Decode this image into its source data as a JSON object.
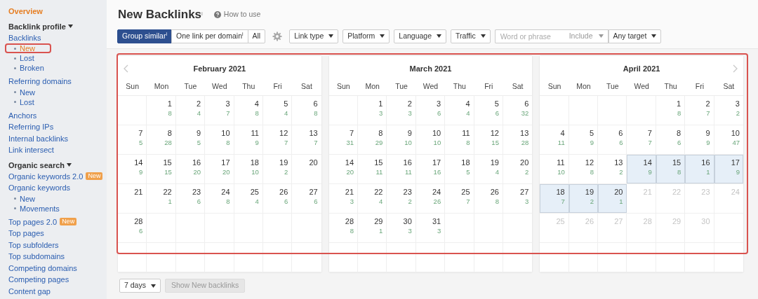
{
  "sidebar": {
    "items": [
      {
        "kind": "top",
        "label": "Overview"
      },
      {
        "kind": "heading",
        "label": "Backlink profile",
        "expanded": true
      },
      {
        "kind": "link",
        "label": "Backlinks",
        "children": [
          {
            "label": "New",
            "selected": true,
            "highlighted": true
          },
          {
            "label": "Lost",
            "selected": false,
            "highlighted": false
          },
          {
            "label": "Broken",
            "selected": false,
            "highlighted": false
          }
        ]
      },
      {
        "kind": "link",
        "label": "Referring domains",
        "children": [
          {
            "label": "New",
            "selected": false,
            "highlighted": false
          },
          {
            "label": "Lost",
            "selected": false,
            "highlighted": false
          }
        ]
      },
      {
        "kind": "link",
        "label": "Anchors"
      },
      {
        "kind": "link",
        "label": "Referring IPs"
      },
      {
        "kind": "link",
        "label": "Internal backlinks"
      },
      {
        "kind": "link",
        "label": "Link intersect"
      },
      {
        "kind": "heading",
        "label": "Organic search",
        "expanded": true
      },
      {
        "kind": "link",
        "label": "Organic keywords 2.0",
        "badge": "New"
      },
      {
        "kind": "link",
        "label": "Organic keywords",
        "children": [
          {
            "label": "New",
            "selected": false,
            "highlighted": false
          },
          {
            "label": "Movements",
            "selected": false,
            "highlighted": false
          }
        ]
      },
      {
        "kind": "link",
        "label": "Top pages 2.0",
        "badge": "New"
      },
      {
        "kind": "link",
        "label": "Top pages"
      },
      {
        "kind": "link",
        "label": "Top subfolders"
      },
      {
        "kind": "link",
        "label": "Top subdomains"
      },
      {
        "kind": "link",
        "label": "Competing domains"
      },
      {
        "kind": "link",
        "label": "Competing pages"
      },
      {
        "kind": "link",
        "label": "Content gap"
      }
    ]
  },
  "header": {
    "title": "New Backlinks$^{i}$",
    "help_link": "How to use"
  },
  "toolbar": {
    "modes": [
      {
        "label": "Group similar$^{i}$",
        "selected": true
      },
      {
        "label": "One link per domain$^{i}$",
        "selected": false
      },
      {
        "label": "All",
        "selected": false
      }
    ],
    "filters": [
      "Link type",
      "Platform",
      "Language",
      "Traffic"
    ],
    "search": {
      "placeholder": "Word or phrase",
      "mode": "Include",
      "target": "Any target"
    }
  },
  "calendar": {
    "highlighted": true,
    "months": [
      {
        "title": "February 2021",
        "prev_button": true,
        "next_button": false,
        "weekdays": [
          "Sun",
          "Mon",
          "Tue",
          "Wed",
          "Thu",
          "Fri",
          "Sat"
        ],
        "weeks": [
          [
            {
              "kind": "blank"
            },
            {
              "kind": "day",
              "day": "1",
              "count": "8",
              "selected": false,
              "disabled": false
            },
            {
              "kind": "day",
              "day": "2",
              "count": "4",
              "selected": false,
              "disabled": false
            },
            {
              "kind": "day",
              "day": "3",
              "count": "7",
              "selected": false,
              "disabled": false
            },
            {
              "kind": "day",
              "day": "4",
              "count": "8",
              "selected": false,
              "disabled": false
            },
            {
              "kind": "day",
              "day": "5",
              "count": "4",
              "selected": false,
              "disabled": false
            },
            {
              "kind": "day",
              "day": "6",
              "count": "8",
              "selected": false,
              "disabled": false
            }
          ],
          [
            {
              "kind": "day",
              "day": "7",
              "count": "5",
              "selected": false,
              "disabled": false
            },
            {
              "kind": "day",
              "day": "8",
              "count": "28",
              "selected": false,
              "disabled": false
            },
            {
              "kind": "day",
              "day": "9",
              "count": "5",
              "selected": false,
              "disabled": false
            },
            {
              "kind": "day",
              "day": "10",
              "count": "8",
              "selected": false,
              "disabled": false
            },
            {
              "kind": "day",
              "day": "11",
              "count": "9",
              "selected": false,
              "disabled": false
            },
            {
              "kind": "day",
              "day": "12",
              "count": "7",
              "selected": false,
              "disabled": false
            },
            {
              "kind": "day",
              "day": "13",
              "count": "7",
              "selected": false,
              "disabled": false
            }
          ],
          [
            {
              "kind": "day",
              "day": "14",
              "count": "9",
              "selected": false,
              "disabled": false
            },
            {
              "kind": "day",
              "day": "15",
              "count": "15",
              "selected": false,
              "disabled": false
            },
            {
              "kind": "day",
              "day": "16",
              "count": "20",
              "selected": false,
              "disabled": false
            },
            {
              "kind": "day",
              "day": "17",
              "count": "20",
              "selected": false,
              "disabled": false
            },
            {
              "kind": "day",
              "day": "18",
              "count": "10",
              "selected": false,
              "disabled": false
            },
            {
              "kind": "day",
              "day": "19",
              "count": "2",
              "selected": false,
              "disabled": false
            },
            {
              "kind": "day",
              "day": "20",
              "selected": false,
              "disabled": false
            }
          ],
          [
            {
              "kind": "day",
              "day": "21",
              "selected": false,
              "disabled": false
            },
            {
              "kind": "day",
              "day": "22",
              "count": "1",
              "selected": false,
              "disabled": false
            },
            {
              "kind": "day",
              "day": "23",
              "count": "6",
              "selected": false,
              "disabled": false
            },
            {
              "kind": "day",
              "day": "24",
              "count": "8",
              "selected": false,
              "disabled": false
            },
            {
              "kind": "day",
              "day": "25",
              "count": "4",
              "selected": false,
              "disabled": false
            },
            {
              "kind": "day",
              "day": "26",
              "count": "6",
              "selected": false,
              "disabled": false
            },
            {
              "kind": "day",
              "day": "27",
              "count": "6",
              "selected": false,
              "disabled": false
            }
          ],
          [
            {
              "kind": "day",
              "day": "28",
              "count": "6",
              "selected": false,
              "disabled": false
            },
            {
              "kind": "blank"
            },
            {
              "kind": "blank"
            },
            {
              "kind": "blank"
            },
            {
              "kind": "blank"
            },
            {
              "kind": "blank"
            },
            {
              "kind": "blank"
            }
          ],
          [
            {
              "kind": "blank"
            },
            {
              "kind": "blank"
            },
            {
              "kind": "blank"
            },
            {
              "kind": "blank"
            },
            {
              "kind": "blank"
            },
            {
              "kind": "blank"
            },
            {
              "kind": "blank"
            }
          ]
        ]
      },
      {
        "title": "March 2021",
        "prev_button": false,
        "next_button": false,
        "weekdays": [
          "Sun",
          "Mon",
          "Tue",
          "Wed",
          "Thu",
          "Fri",
          "Sat"
        ],
        "weeks": [
          [
            {
              "kind": "blank"
            },
            {
              "kind": "day",
              "day": "1",
              "count": "3",
              "selected": false,
              "disabled": false
            },
            {
              "kind": "day",
              "day": "2",
              "count": "3",
              "selected": false,
              "disabled": false
            },
            {
              "kind": "day",
              "day": "3",
              "count": "6",
              "selected": false,
              "disabled": false
            },
            {
              "kind": "day",
              "day": "4",
              "count": "4",
              "selected": false,
              "disabled": false
            },
            {
              "kind": "day",
              "day": "5",
              "count": "6",
              "selected": false,
              "disabled": false
            },
            {
              "kind": "day",
              "day": "6",
              "count": "32",
              "selected": false,
              "disabled": false
            }
          ],
          [
            {
              "kind": "day",
              "day": "7",
              "count": "31",
              "selected": false,
              "disabled": false
            },
            {
              "kind": "day",
              "day": "8",
              "count": "29",
              "selected": false,
              "disabled": false
            },
            {
              "kind": "day",
              "day": "9",
              "count": "10",
              "selected": false,
              "disabled": false
            },
            {
              "kind": "day",
              "day": "10",
              "count": "10",
              "selected": false,
              "disabled": false
            },
            {
              "kind": "day",
              "day": "11",
              "count": "8",
              "selected": false,
              "disabled": false
            },
            {
              "kind": "day",
              "day": "12",
              "count": "15",
              "selected": false,
              "disabled": false
            },
            {
              "kind": "day",
              "day": "13",
              "count": "28",
              "selected": false,
              "disabled": false
            }
          ],
          [
            {
              "kind": "day",
              "day": "14",
              "count": "20",
              "selected": false,
              "disabled": false
            },
            {
              "kind": "day",
              "day": "15",
              "count": "11",
              "selected": false,
              "disabled": false
            },
            {
              "kind": "day",
              "day": "16",
              "count": "11",
              "selected": false,
              "disabled": false
            },
            {
              "kind": "day",
              "day": "17",
              "count": "16",
              "selected": false,
              "disabled": false
            },
            {
              "kind": "day",
              "day": "18",
              "count": "5",
              "selected": false,
              "disabled": false
            },
            {
              "kind": "day",
              "day": "19",
              "count": "4",
              "selected": false,
              "disabled": false
            },
            {
              "kind": "day",
              "day": "20",
              "count": "2",
              "selected": false,
              "disabled": false
            }
          ],
          [
            {
              "kind": "day",
              "day": "21",
              "count": "3",
              "selected": false,
              "disabled": false
            },
            {
              "kind": "day",
              "day": "22",
              "count": "4",
              "selected": false,
              "disabled": false
            },
            {
              "kind": "day",
              "day": "23",
              "count": "2",
              "selected": false,
              "disabled": false
            },
            {
              "kind": "day",
              "day": "24",
              "count": "26",
              "selected": false,
              "disabled": false
            },
            {
              "kind": "day",
              "day": "25",
              "count": "7",
              "selected": false,
              "disabled": false
            },
            {
              "kind": "day",
              "day": "26",
              "count": "8",
              "selected": false,
              "disabled": false
            },
            {
              "kind": "day",
              "day": "27",
              "count": "3",
              "selected": false,
              "disabled": false
            }
          ],
          [
            {
              "kind": "day",
              "day": "28",
              "count": "8",
              "selected": false,
              "disabled": false
            },
            {
              "kind": "day",
              "day": "29",
              "count": "1",
              "selected": false,
              "disabled": false
            },
            {
              "kind": "day",
              "day": "30",
              "count": "3",
              "selected": false,
              "disabled": false
            },
            {
              "kind": "day",
              "day": "31",
              "count": "3",
              "selected": false,
              "disabled": false
            },
            {
              "kind": "blank"
            },
            {
              "kind": "blank"
            },
            {
              "kind": "blank"
            }
          ],
          [
            {
              "kind": "blank"
            },
            {
              "kind": "blank"
            },
            {
              "kind": "blank"
            },
            {
              "kind": "blank"
            },
            {
              "kind": "blank"
            },
            {
              "kind": "blank"
            },
            {
              "kind": "blank"
            }
          ]
        ]
      },
      {
        "title": "April 2021",
        "prev_button": false,
        "next_button": true,
        "weekdays": [
          "Sun",
          "Mon",
          "Tue",
          "Wed",
          "Thu",
          "Fri",
          "Sat"
        ],
        "weeks": [
          [
            {
              "kind": "blank"
            },
            {
              "kind": "blank"
            },
            {
              "kind": "blank"
            },
            {
              "kind": "blank"
            },
            {
              "kind": "day",
              "day": "1",
              "count": "8",
              "selected": false,
              "disabled": false
            },
            {
              "kind": "day",
              "day": "2",
              "count": "7",
              "selected": false,
              "disabled": false
            },
            {
              "kind": "day",
              "day": "3",
              "count": "2",
              "selected": false,
              "disabled": false
            }
          ],
          [
            {
              "kind": "day",
              "day": "4",
              "count": "11",
              "selected": false,
              "disabled": false
            },
            {
              "kind": "day",
              "day": "5",
              "count": "9",
              "selected": false,
              "disabled": false
            },
            {
              "kind": "day",
              "day": "6",
              "count": "6",
              "selected": false,
              "disabled": false
            },
            {
              "kind": "day",
              "day": "7",
              "count": "7",
              "selected": false,
              "disabled": false
            },
            {
              "kind": "day",
              "day": "8",
              "count": "6",
              "selected": false,
              "disabled": false
            },
            {
              "kind": "day",
              "day": "9",
              "count": "9",
              "selected": false,
              "disabled": false
            },
            {
              "kind": "day",
              "day": "10",
              "count": "47",
              "selected": false,
              "disabled": false
            }
          ],
          [
            {
              "kind": "day",
              "day": "11",
              "count": "10",
              "selected": false,
              "disabled": false
            },
            {
              "kind": "day",
              "day": "12",
              "count": "8",
              "selected": false,
              "disabled": false
            },
            {
              "kind": "day",
              "day": "13",
              "count": "2",
              "selected": false,
              "disabled": false
            },
            {
              "kind": "day",
              "day": "14",
              "count": "9",
              "selected": true,
              "disabled": false
            },
            {
              "kind": "day",
              "day": "15",
              "count": "8",
              "selected": true,
              "disabled": false
            },
            {
              "kind": "day",
              "day": "16",
              "count": "1",
              "selected": true,
              "disabled": false
            },
            {
              "kind": "day",
              "day": "17",
              "count": "9",
              "selected": true,
              "disabled": false
            }
          ],
          [
            {
              "kind": "day",
              "day": "18",
              "count": "7",
              "selected": true,
              "disabled": false
            },
            {
              "kind": "day",
              "day": "19",
              "count": "2",
              "selected": true,
              "disabled": false
            },
            {
              "kind": "day",
              "day": "20",
              "count": "1",
              "selected": true,
              "disabled": false
            },
            {
              "kind": "day",
              "day": "21",
              "selected": false,
              "disabled": true
            },
            {
              "kind": "day",
              "day": "22",
              "selected": false,
              "disabled": true
            },
            {
              "kind": "day",
              "day": "23",
              "selected": false,
              "disabled": true
            },
            {
              "kind": "day",
              "day": "24",
              "selected": false,
              "disabled": true
            }
          ],
          [
            {
              "kind": "day",
              "day": "25",
              "selected": false,
              "disabled": true
            },
            {
              "kind": "day",
              "day": "26",
              "selected": false,
              "disabled": true
            },
            {
              "kind": "day",
              "day": "27",
              "selected": false,
              "disabled": true
            },
            {
              "kind": "day",
              "day": "28",
              "selected": false,
              "disabled": true
            },
            {
              "kind": "day",
              "day": "29",
              "selected": false,
              "disabled": true
            },
            {
              "kind": "day",
              "day": "30",
              "selected": false,
              "disabled": true
            },
            {
              "kind": "blank"
            }
          ],
          [
            {
              "kind": "blank"
            },
            {
              "kind": "blank"
            },
            {
              "kind": "blank"
            },
            {
              "kind": "blank"
            },
            {
              "kind": "blank"
            },
            {
              "kind": "blank"
            },
            {
              "kind": "blank"
            }
          ]
        ]
      }
    ]
  },
  "footer": {
    "period": "7 days",
    "action": {
      "label": "Show New backlinks",
      "disabled": true
    }
  }
}
